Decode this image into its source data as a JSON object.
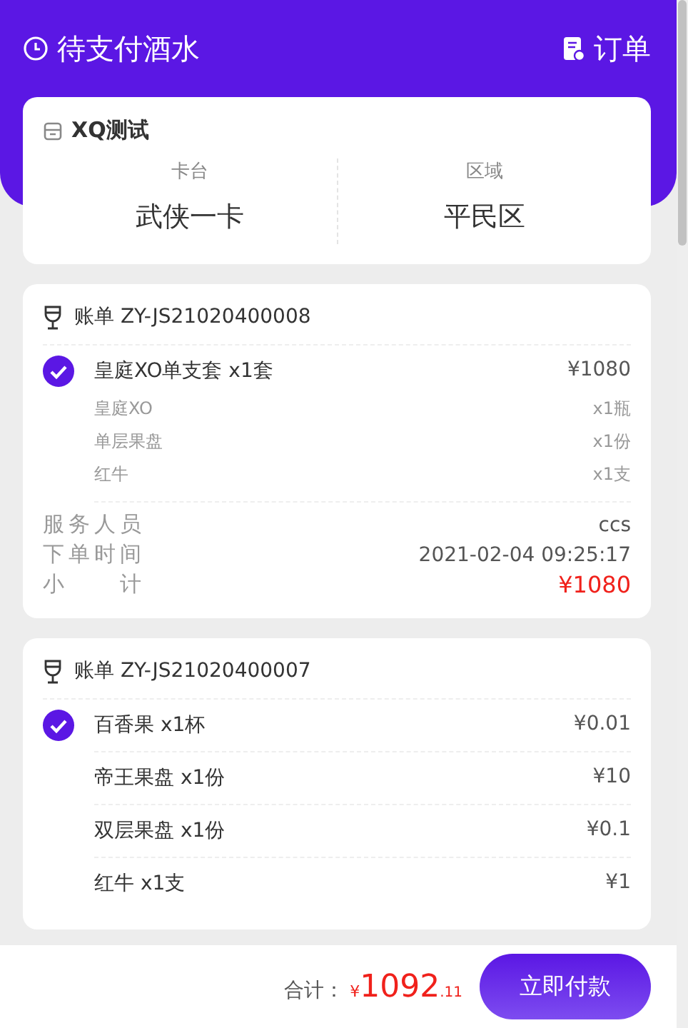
{
  "header": {
    "title": "待支付酒水",
    "order_link": "订单"
  },
  "store": {
    "name": "XQ测试",
    "fields": [
      {
        "label": "卡台",
        "value": "武侠一卡"
      },
      {
        "label": "区域",
        "value": "平民区"
      }
    ]
  },
  "bills": [
    {
      "title": "账单 ZY-JS21020400008",
      "checked": true,
      "items": [
        {
          "name": "皇庭XO单支套 x1套",
          "price": "¥1080",
          "components": [
            {
              "name": "皇庭XO",
              "qty": "x1瓶"
            },
            {
              "name": "单层果盘",
              "qty": "x1份"
            },
            {
              "name": "红牛",
              "qty": "x1支"
            }
          ]
        }
      ],
      "details": [
        {
          "label": "服务人员",
          "value": "ccs",
          "kind": "plain"
        },
        {
          "label": "下单时间",
          "value": "2021-02-04 09:25:17",
          "kind": "plain"
        },
        {
          "label": "小　　计",
          "value": "¥1080",
          "kind": "total"
        }
      ]
    },
    {
      "title": "账单 ZY-JS21020400007",
      "checked": true,
      "items": [
        {
          "name": "百香果 x1杯",
          "price": "¥0.01"
        },
        {
          "name": "帝王果盘 x1份",
          "price": "¥10"
        },
        {
          "name": "双层果盘 x1份",
          "price": "¥0.1"
        },
        {
          "name": "红牛 x1支",
          "price": "¥1"
        }
      ]
    }
  ],
  "footer": {
    "label": "合计：",
    "currency": "¥",
    "amount": "1092",
    "decimals": ".11",
    "pay_button": "立即付款"
  }
}
